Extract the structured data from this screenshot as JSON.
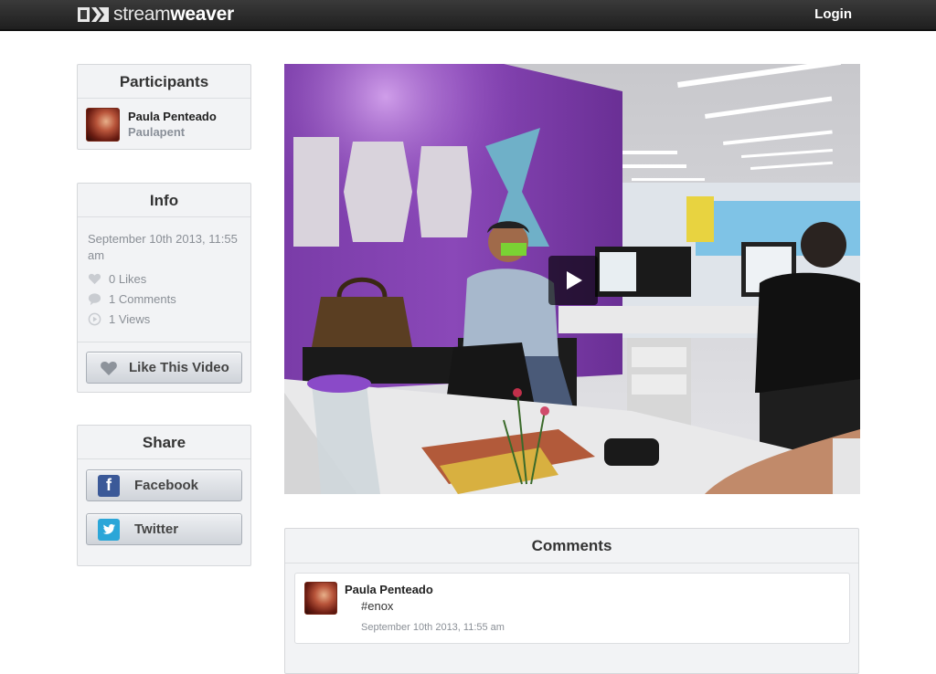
{
  "header": {
    "logo_light": "stream",
    "logo_bold": "weaver",
    "login_label": "Login"
  },
  "participants": {
    "title": "Participants",
    "items": [
      {
        "name": "Paula Penteado",
        "username": "Paulapent"
      }
    ]
  },
  "info": {
    "title": "Info",
    "date": "September 10th 2013, 11:55 am",
    "likes": "0 Likes",
    "comments": "1 Comments",
    "views": "1 Views",
    "like_button": "Like This Video"
  },
  "share": {
    "title": "Share",
    "facebook": "Facebook",
    "twitter": "Twitter"
  },
  "video": {
    "play_icon": "play-icon"
  },
  "comments": {
    "title": "Comments",
    "items": [
      {
        "author": "Paula Penteado",
        "text": "#enox",
        "time": "September 10th 2013, 11:55 am"
      }
    ]
  },
  "colors": {
    "topbar": "#2b2b2b",
    "panel_bg": "#f2f3f5",
    "muted_text": "#8a8f96",
    "facebook": "#3b5998",
    "twitter": "#2ba6d8"
  }
}
